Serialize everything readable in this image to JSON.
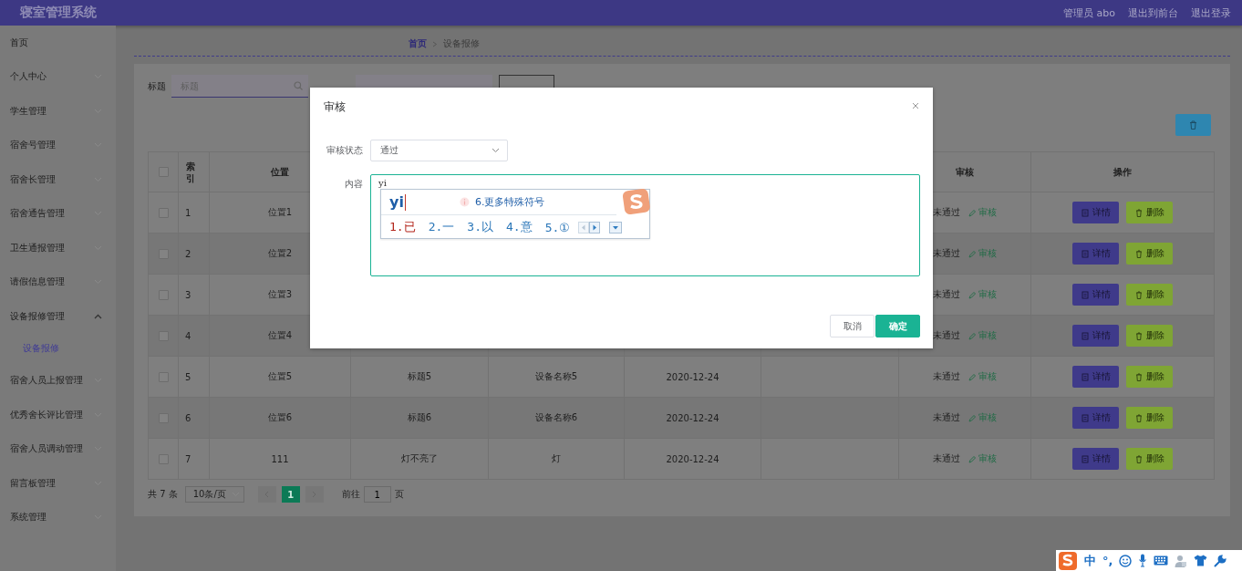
{
  "header": {
    "title": "寝室管理系统",
    "user": "管理员 abo",
    "links": [
      "退出到前台",
      "退出登录"
    ]
  },
  "sidebar": {
    "items": [
      {
        "label": "首页",
        "kind": "link"
      },
      {
        "label": "个人中心",
        "kind": "menu",
        "expanded": false
      },
      {
        "label": "学生管理",
        "kind": "menu",
        "expanded": false
      },
      {
        "label": "宿舍号管理",
        "kind": "menu",
        "expanded": false
      },
      {
        "label": "宿舍长管理",
        "kind": "menu",
        "expanded": false
      },
      {
        "label": "宿舍通告管理",
        "kind": "menu",
        "expanded": false
      },
      {
        "label": "卫生通报管理",
        "kind": "menu",
        "expanded": false
      },
      {
        "label": "请假信息管理",
        "kind": "menu",
        "expanded": false
      },
      {
        "label": "设备报修管理",
        "kind": "menu",
        "expanded": true,
        "children": [
          {
            "label": "设备报修",
            "selected": true
          }
        ]
      },
      {
        "label": "宿舍人员上报管理",
        "kind": "menu",
        "expanded": false
      },
      {
        "label": "优秀舍长评比管理",
        "kind": "menu",
        "expanded": false
      },
      {
        "label": "宿舍人员调动管理",
        "kind": "menu",
        "expanded": false
      },
      {
        "label": "留言板管理",
        "kind": "menu",
        "expanded": false
      },
      {
        "label": "系统管理",
        "kind": "menu",
        "expanded": false
      }
    ]
  },
  "breadcrumb": [
    "首页",
    "设备报修"
  ],
  "search": {
    "label": "标题",
    "placeholder": "标题"
  },
  "table": {
    "select_all_checked": false,
    "columns": [
      {
        "label": "索引"
      },
      {
        "label": "位置"
      },
      {},
      {},
      {},
      {},
      {
        "label": "审核"
      },
      {
        "label": "操作"
      }
    ],
    "rows": [
      {
        "checked": false,
        "cells": [
          "1",
          "位置1"
        ],
        "audit": "未通过",
        "audit_link": "审核",
        "actions": [
          "详情",
          "删除"
        ]
      },
      {
        "checked": false,
        "cells": [
          "2",
          "位置2"
        ],
        "audit": "未通过",
        "audit_link": "审核",
        "actions": [
          "详情",
          "删除"
        ]
      },
      {
        "checked": false,
        "cells": [
          "3",
          "位置3"
        ],
        "audit": "未通过",
        "audit_link": "审核",
        "actions": [
          "详情",
          "删除"
        ]
      },
      {
        "checked": false,
        "cells": [
          "4",
          "位置4"
        ],
        "audit": "未通过",
        "audit_link": "审核",
        "actions": [
          "详情",
          "删除"
        ]
      },
      {
        "checked": false,
        "cells": [
          "5",
          "位置5",
          "标题5",
          "设备名称5",
          "2020-12-24"
        ],
        "audit": "未通过",
        "audit_link": "审核",
        "actions": [
          "详情",
          "删除"
        ]
      },
      {
        "checked": false,
        "cells": [
          "6",
          "位置6",
          "标题6",
          "设备名称6",
          "2020-12-24"
        ],
        "audit": "未通过",
        "audit_link": "审核",
        "actions": [
          "详情",
          "删除"
        ]
      },
      {
        "checked": false,
        "cells": [
          "7",
          "111",
          "灯不亮了",
          "灯",
          "2020-12-24"
        ],
        "audit": "未通过",
        "audit_link": "审核",
        "actions": [
          "详情",
          "删除"
        ]
      }
    ]
  },
  "pagination": {
    "total": "共 7 条",
    "page_size": "10条/页",
    "pages": [
      {
        "label": "1",
        "selected": true
      }
    ],
    "goto_label": "前往",
    "goto_value": "1",
    "goto_suffix": "页"
  },
  "modal": {
    "title": "审核",
    "status_label": "审核状态",
    "status_value": "通过",
    "content_label": "内容",
    "content_value": "yi",
    "buttons": [
      "取消",
      "确定"
    ]
  },
  "ime_popup": {
    "composition": "yi",
    "hint": "6.更多特殊符号",
    "candidates": [
      {
        "label": "1.已",
        "selected": true
      },
      {
        "label": "2.一",
        "selected": false
      },
      {
        "label": "3.以",
        "selected": false
      },
      {
        "label": "4.意",
        "selected": false
      },
      {
        "label": "5.①",
        "selected": false
      }
    ]
  },
  "ime_toolbar": {
    "mode": "中",
    "punct": "°,"
  }
}
